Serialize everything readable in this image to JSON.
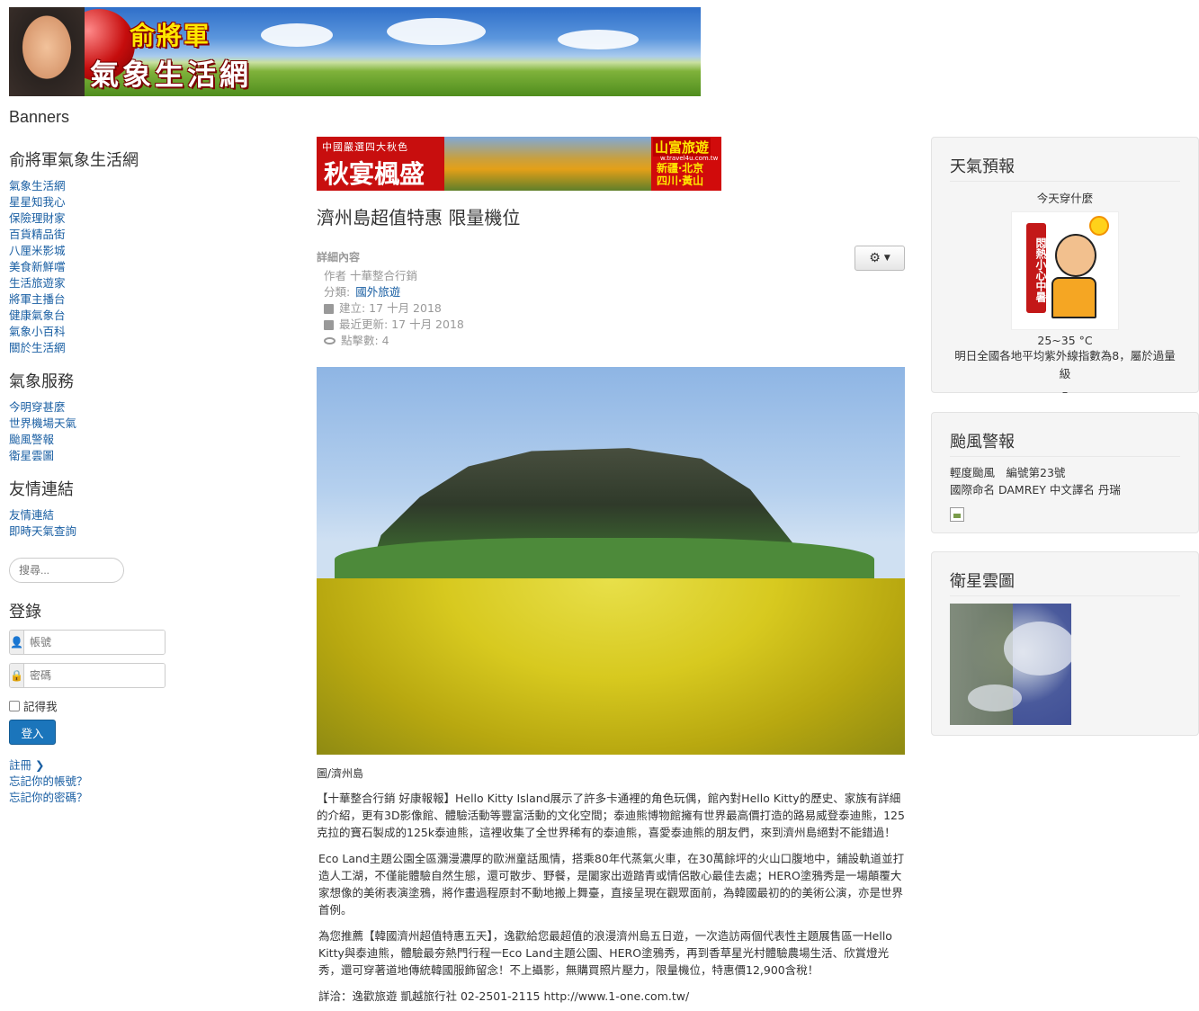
{
  "header": {
    "title_line1": "俞將軍",
    "title_line2": "氣象生活網"
  },
  "banners_label": "Banners",
  "left_sidebar": {
    "menu1": {
      "title": "俞將軍氣象生活網",
      "items": [
        "氣象生活網",
        "星星知我心",
        "保險理財家",
        "百貨精品街",
        "八厘米影城",
        "美食新鮮嚐",
        "生活旅遊家",
        "將軍主播台",
        "健康氣象台",
        "氣象小百科",
        "關於生活網"
      ]
    },
    "menu2": {
      "title": "氣象服務",
      "items": [
        "今明穿甚麼",
        "世界機場天氣",
        "颱風警報",
        "衛星雲圖"
      ]
    },
    "menu3": {
      "title": "友情連結",
      "items": [
        "友情連結",
        "即時天氣查詢"
      ]
    },
    "search": {
      "placeholder": "搜尋..."
    },
    "login": {
      "title": "登錄",
      "username_placeholder": "帳號",
      "password_placeholder": "密碼",
      "remember_label": "記得我",
      "login_button": "登入",
      "links": [
        "註冊",
        "忘記你的帳號？",
        "忘記你的密碼？"
      ]
    }
  },
  "ad": {
    "top_text": "中國嚴選四大秋色",
    "big_text": "秋宴楓盛",
    "brand": "山富旅遊",
    "url": "w.travel4u.com.tw",
    "dest_line1": "新疆‧北京",
    "dest_line2": "四川‧黃山"
  },
  "article": {
    "title": "濟州島超值特惠 限量機位",
    "info_label": "詳細內容",
    "author": "作者 十華整合行銷",
    "category_prefix": "分類:",
    "category": "國外旅遊",
    "created": "建立: 17 十月 2018",
    "modified": "最近更新: 17 十月 2018",
    "hits": "點擊數: 4",
    "caption": "圖/濟州島",
    "paragraphs": [
      "【十華整合行銷 好康報報】Hello Kitty Island展示了許多卡通裡的角色玩偶，館內對Hello Kitty的歷史、家族有詳細的介紹，更有3D影像館、體驗活動等豐富活動的文化空間；泰迪熊博物館擁有世界最高價打造的路易威登泰迪熊，125克拉的寶石製成的125k泰迪熊，這裡收集了全世界稀有的泰迪熊，喜愛泰迪熊的朋友們，來到濟州島絕對不能錯過！",
      " Eco Land主題公園全區瀰漫濃厚的歐洲童話風情，搭乘80年代蒸氣火車，在30萬餘坪的火山口腹地中，鋪設軌道並打造人工湖，不僅能體驗自然生態，還可散步、野餐，是闔家出遊踏青或情侶散心最佳去處；HERO塗鴉秀是一場顛覆大家想像的美術表演塗鴉，將作畫過程原封不動地搬上舞臺，直接呈現在觀眾面前，為韓國最初的的美術公演，亦是世界首例。",
      " 為您推薦【韓國濟州超值特惠五天】，逸歡給您最超值的浪漫濟州島五日遊，一次造訪兩個代表性主題展售區一Hello Kitty與泰迪熊，體驗最夯熱門行程一Eco Land主題公園、HERO塗鴉秀，再到香草星光村體驗農場生活、欣賞燈光秀，還可穿著道地傳統韓國服飾留念！不上攝影，無購買照片壓力，限量機位，特惠價12,900含稅！",
      " 詳洽：逸歡旅遊 凱越旅行社 02-2501-2115 http://www.1-one.com.tw/"
    ]
  },
  "right_sidebar": {
    "weather": {
      "title": "天氣預報",
      "subtitle": "今天穿什麼",
      "tag_text": "悶熱小心中暑",
      "temp": "25~35 °C",
      "uv_text": "明日全國各地平均紫外線指數為8，屬於過量級",
      "uv_dash": "–"
    },
    "typhoon": {
      "title": "颱風警報",
      "line1": "輕度颱風　編號第23號",
      "line2": "國際命名  DAMREY  中文譯名  丹瑞"
    },
    "satellite": {
      "title": "衛星雲圖"
    }
  }
}
